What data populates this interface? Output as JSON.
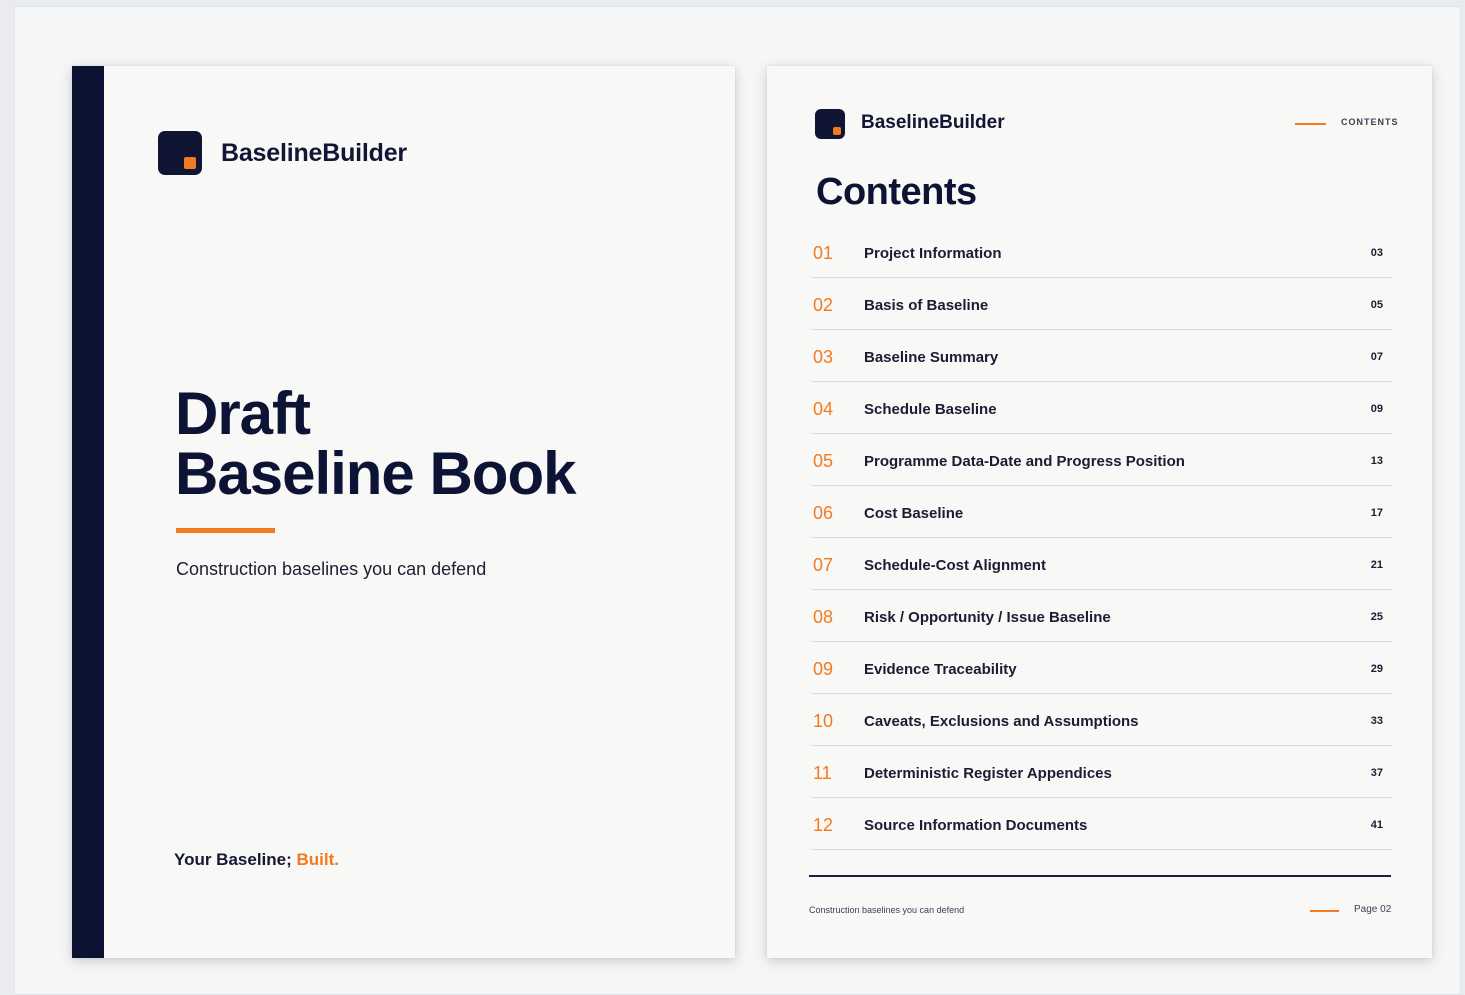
{
  "brand": {
    "name": "BaselineBuilder",
    "accent": "#f37a1f",
    "navy": "#0b1233"
  },
  "cover": {
    "title_line1": "Draft",
    "title_line2": "Baseline Book",
    "tagline": "Construction baselines you can defend",
    "slogan_main": "Your Baseline; ",
    "slogan_highlight": "Built."
  },
  "contents": {
    "header_label": "CONTENTS",
    "heading": "Contents",
    "items": [
      {
        "num": "01",
        "label": "Project Information",
        "page": "03"
      },
      {
        "num": "02",
        "label": "Basis of Baseline",
        "page": "05"
      },
      {
        "num": "03",
        "label": "Baseline Summary",
        "page": "07"
      },
      {
        "num": "04",
        "label": "Schedule Baseline",
        "page": "09"
      },
      {
        "num": "05",
        "label": "Programme Data-Date and Progress Position",
        "page": "13"
      },
      {
        "num": "06",
        "label": "Cost Baseline",
        "page": "17"
      },
      {
        "num": "07",
        "label": "Schedule-Cost Alignment",
        "page": "21"
      },
      {
        "num": "08",
        "label": "Risk / Opportunity / Issue Baseline",
        "page": "25"
      },
      {
        "num": "09",
        "label": "Evidence Traceability",
        "page": "29"
      },
      {
        "num": "10",
        "label": "Caveats, Exclusions and Assumptions",
        "page": "33"
      },
      {
        "num": "11",
        "label": "Deterministic Register Appendices",
        "page": "37"
      },
      {
        "num": "12",
        "label": "Source Information Documents",
        "page": "41"
      }
    ],
    "footer_text": "Construction baselines you can defend",
    "footer_page": "Page 02"
  }
}
